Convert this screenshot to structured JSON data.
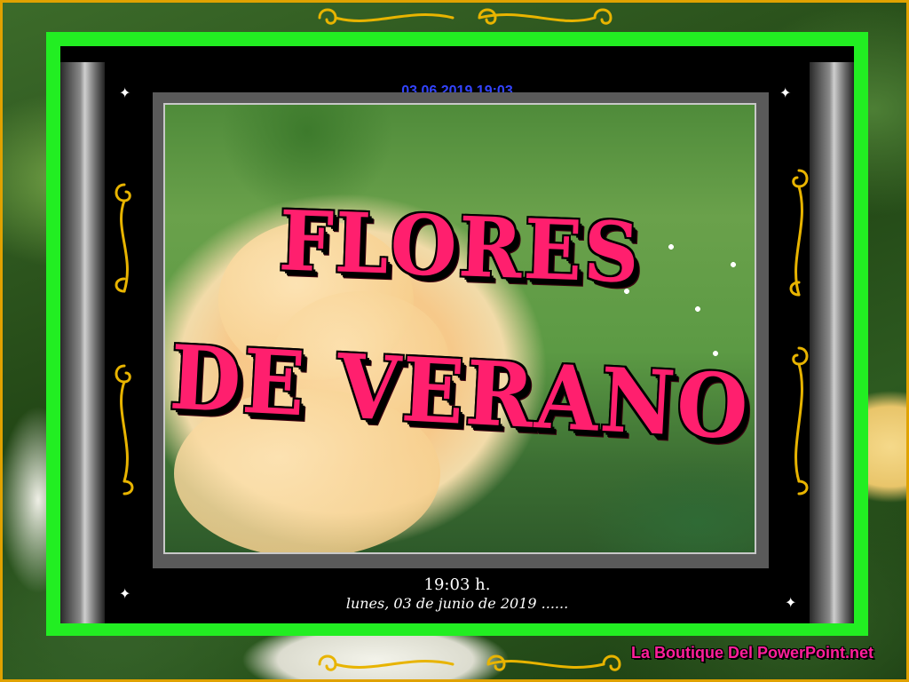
{
  "header": {
    "datetime": "03.06.2019 19:03"
  },
  "title": {
    "line1": "FLORES",
    "line2": "DE VERANO"
  },
  "footer": {
    "time": "19:03 h.",
    "date_long": "lunes, 03 de junio de 2019 ......"
  },
  "brand": {
    "label": "La Boutique Del PowerPoint.net"
  },
  "colors": {
    "frame_green": "#22ee22",
    "title_pink": "#ff1f6e",
    "date_blue": "#3344ff",
    "gold": "#e0a200",
    "brand_pink": "#ff1f9a"
  },
  "icons": [
    "sparkle-icon",
    "gold-scroll-ornament"
  ]
}
